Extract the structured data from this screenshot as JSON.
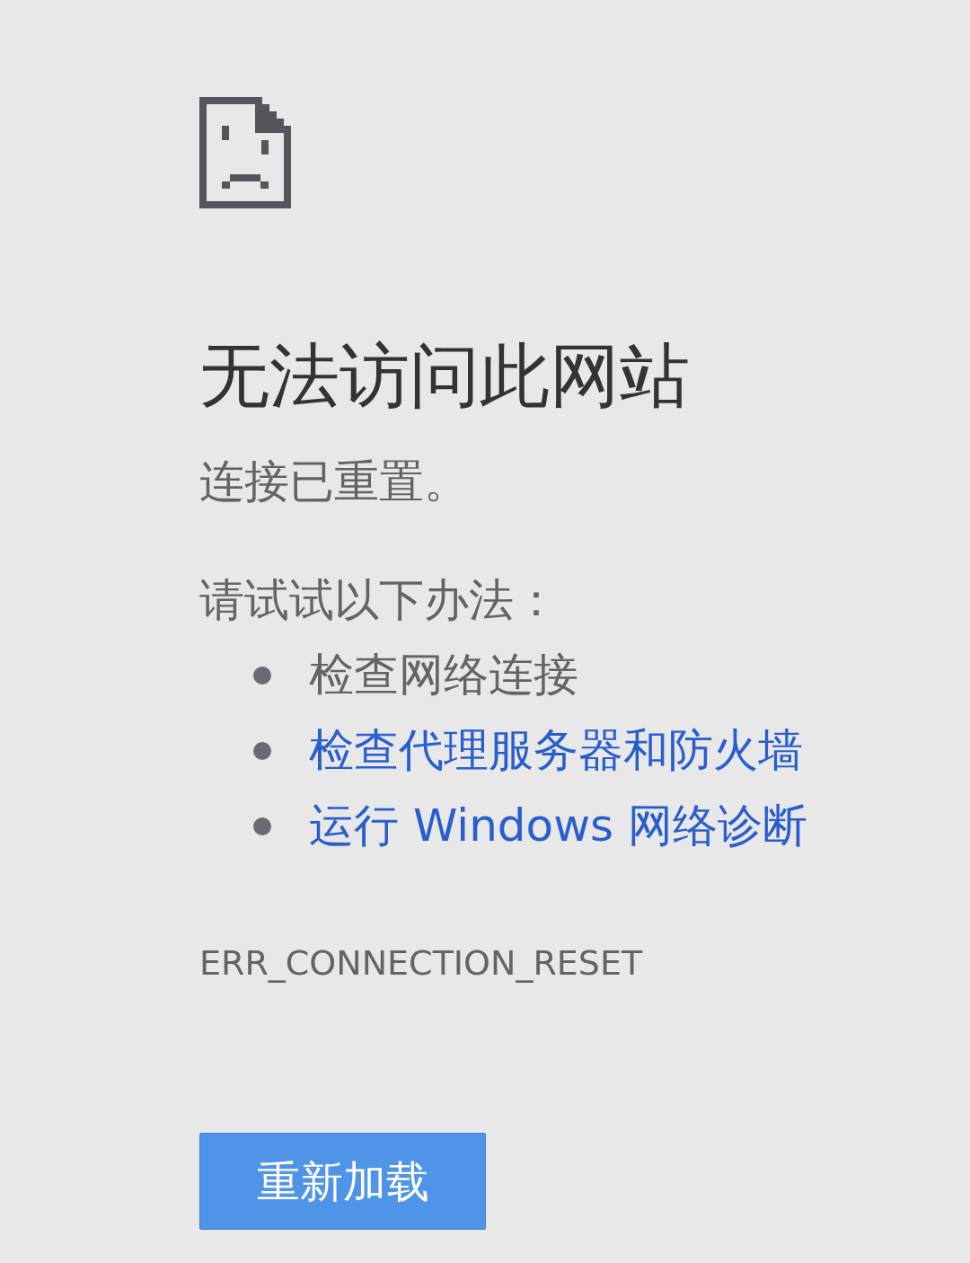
{
  "heading": "无法访问此网站",
  "summary": "连接已重置。",
  "suggestions_title": "请试试以下办法：",
  "suggestions": [
    {
      "kind": "text",
      "text": "检查网络连接"
    },
    {
      "kind": "link",
      "text": "检查代理服务器和防火墙"
    },
    {
      "kind": "link",
      "text": "运行 Windows 网络诊断"
    }
  ],
  "error_code": "ERR_CONNECTION_RESET",
  "button": {
    "label": "重新加载"
  }
}
